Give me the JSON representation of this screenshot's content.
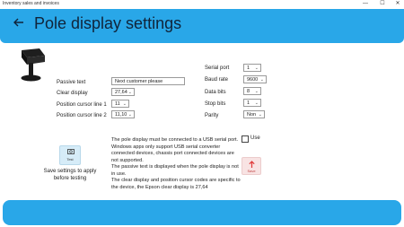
{
  "window": {
    "title": "Inventory sales and invoices",
    "minimize": "—",
    "maximize": "☐",
    "close": "✕"
  },
  "header": {
    "back_icon": "arrow-left-icon",
    "title": "Pole display settings",
    "color": "#29a7e8"
  },
  "form": {
    "passive_text_label": "Passive text",
    "passive_text_value": "Next customer please",
    "clear_display_label": "Clear display",
    "clear_display_value": "27,64",
    "cursor_line1_label": "Position cursor line 1",
    "cursor_line1_value": "11",
    "cursor_line2_label": "Position cursor line 2",
    "cursor_line2_value": "11,10",
    "serial_port_label": "Serial port",
    "serial_port_value": "1",
    "baud_rate_label": "Baud rate",
    "baud_rate_value": "9600",
    "data_bits_label": "Data bits",
    "data_bits_value": "8",
    "stop_bits_label": "Stop bits",
    "stop_bits_value": "1",
    "parity_label": "Parity",
    "parity_value": "Non"
  },
  "use_checkbox_label": "Use",
  "test_button_label": "Test",
  "save_button_label": "Save",
  "save_hint": "Save settings to apply before testing",
  "info_paragraphs": [
    "The pole display must be connected to a USB serial port.",
    "Windows apps only support USB serial converter connected devices, chassis port connected devices are not supported.",
    "The passive text is displayed when the pole display is not in use.",
    "The clear display and position cursor codes are specific to the device, the Epson clear display is 27,64"
  ]
}
